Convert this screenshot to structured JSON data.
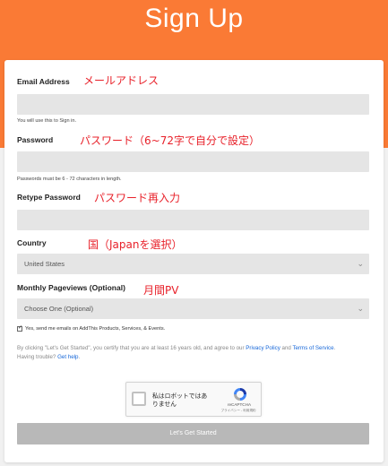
{
  "header": {
    "title": "Sign Up"
  },
  "form": {
    "email": {
      "label": "Email Address",
      "annotation": "メールアドレス",
      "value": "",
      "help": "You will use this to Sign in."
    },
    "password": {
      "label": "Password",
      "annotation": "パスワード（6~72字で自分で設定）",
      "value": "",
      "help": "Passwords must be 6 - 72 characters in length."
    },
    "retype_password": {
      "label": "Retype Password",
      "annotation": "パスワード再入力",
      "value": ""
    },
    "country": {
      "label": "Country",
      "annotation": "国（Japanを選択）",
      "selected": "United States"
    },
    "pageviews": {
      "label": "Monthly Pageviews (Optional)",
      "annotation": "月間PV",
      "selected": "Choose One (Optional)"
    },
    "consent": {
      "checked": true,
      "text": "Yes, send me emails on AddThis Products, Services, & Events."
    },
    "legal": {
      "prefix": "By clicking \"Let's Get Started\", you certify that you are at least 16 years old, and agree to our ",
      "privacy_link": "Privacy Policy",
      "and": " and ",
      "terms_link": "Terms of Service",
      "suffix": ".",
      "trouble": "Having trouble? ",
      "help_link": "Get help",
      "help_suffix": "."
    },
    "recaptcha": {
      "label": "私はロボットではありません",
      "brand": "reCAPTCHA",
      "sub": "プライバシー - 利用規約"
    },
    "submit_label": "Let's Get Started"
  },
  "colors": {
    "banner": "#fa7a35",
    "annotation": "#e8212a",
    "link": "#1566d8",
    "button": "#b8b8b8"
  }
}
